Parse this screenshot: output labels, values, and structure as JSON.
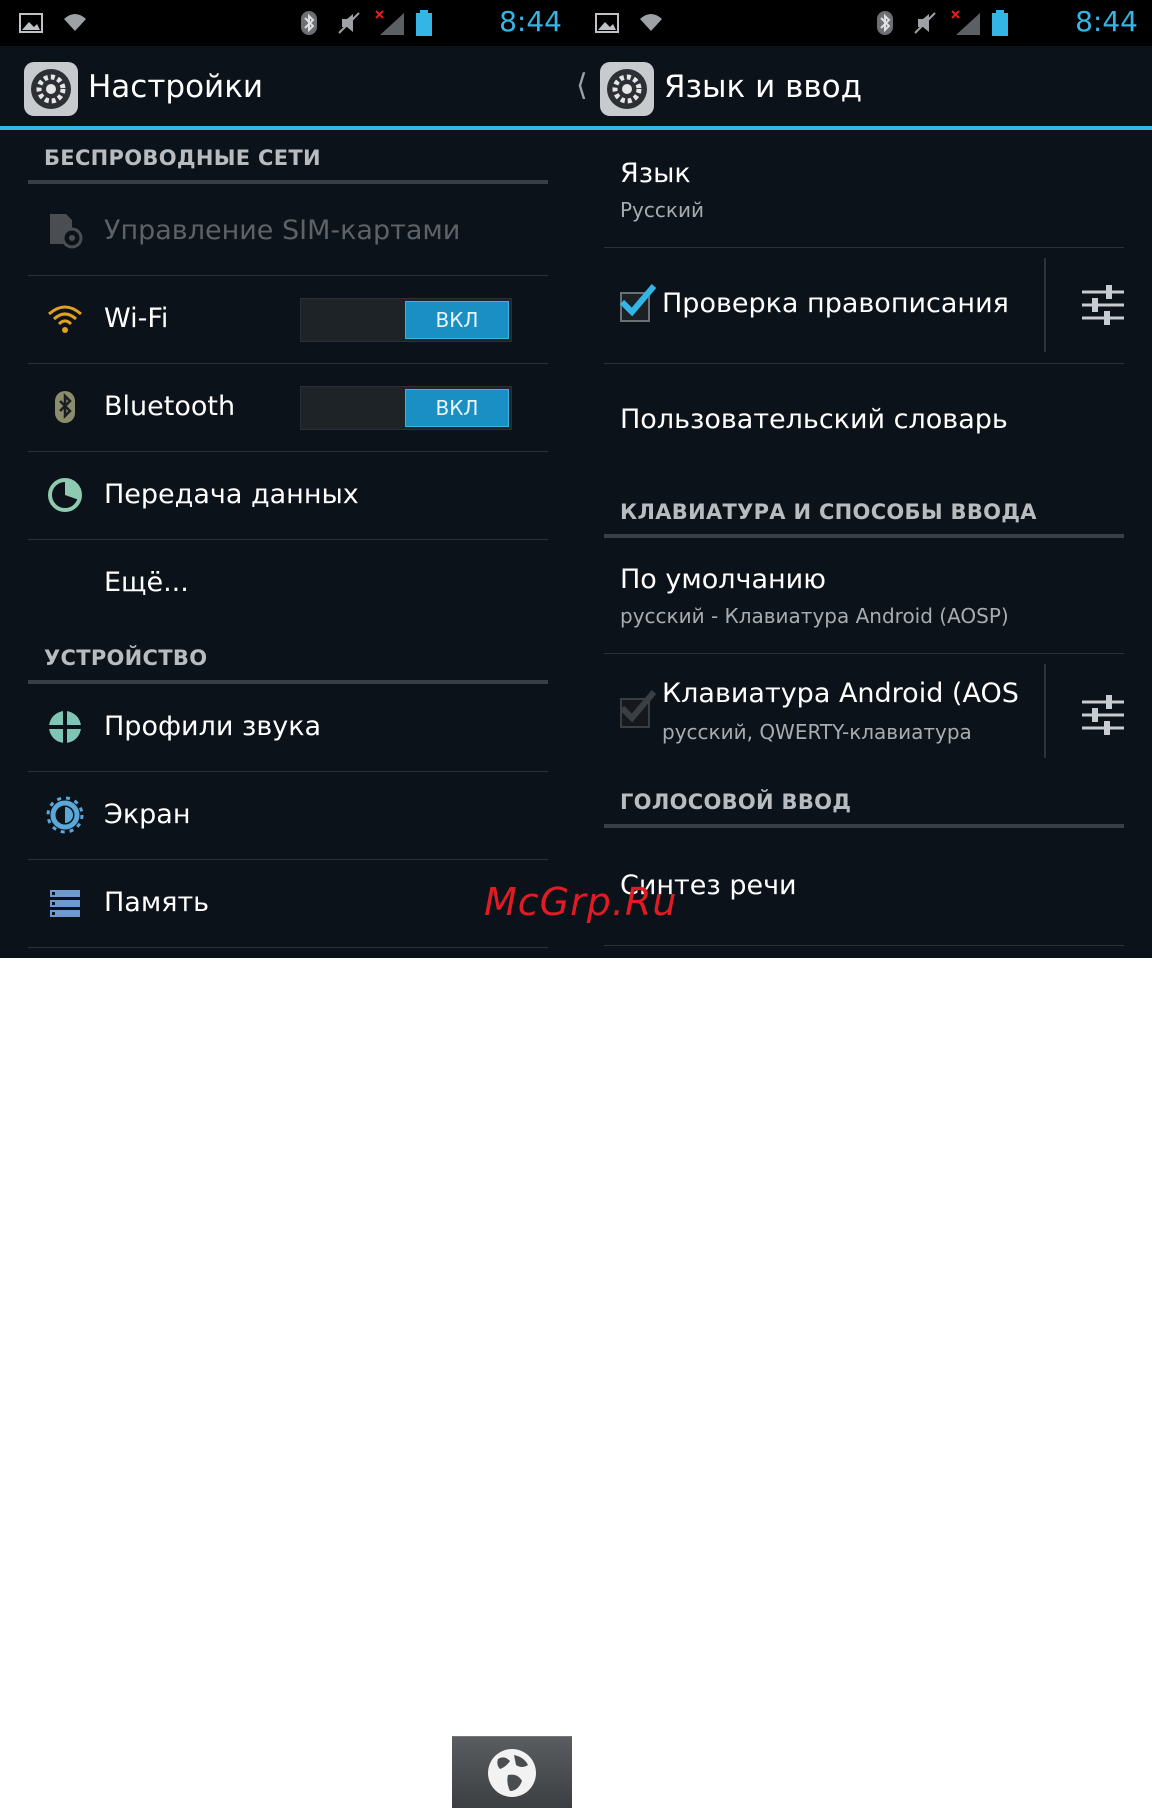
{
  "status_bar": {
    "time": "8:44"
  },
  "left": {
    "title": "Настройки",
    "sections": {
      "wireless": "БЕСПРОВОДНЫЕ СЕТИ",
      "device": "УСТРОЙСТВО"
    },
    "items": {
      "sim": "Управление SIM-картами",
      "wifi": "Wi-Fi",
      "wifi_toggle": "ВКЛ",
      "bluetooth": "Bluetooth",
      "bluetooth_toggle": "ВКЛ",
      "data": "Передача данных",
      "more": "Ещё...",
      "sound": "Профили звука",
      "screen": "Экран",
      "memory": "Память"
    }
  },
  "right": {
    "title": "Язык и ввод",
    "language": {
      "title": "Язык",
      "value": "Русский"
    },
    "spellcheck": {
      "title": "Проверка правописания",
      "checked": true
    },
    "user_dict": "Пользовательский словарь",
    "sections": {
      "keyboard": "КЛАВИАТУРА И СПОСОБЫ ВВОДА",
      "voice": "ГОЛОСОВОЙ ВВОД"
    },
    "default_kb": {
      "title": "По умолчанию",
      "value": "русский - Клавиатура Android (AOSP)"
    },
    "android_kb": {
      "title": "Клавиатура Android (AOS",
      "value": "русский, QWERTY-клавиатура",
      "checked": true
    },
    "tts": "Синтез речи"
  },
  "watermark": "McGrp.Ru",
  "colors": {
    "accent": "#33b5e5",
    "background": "#0c1219",
    "toggle_on": "#1a8fc4"
  }
}
